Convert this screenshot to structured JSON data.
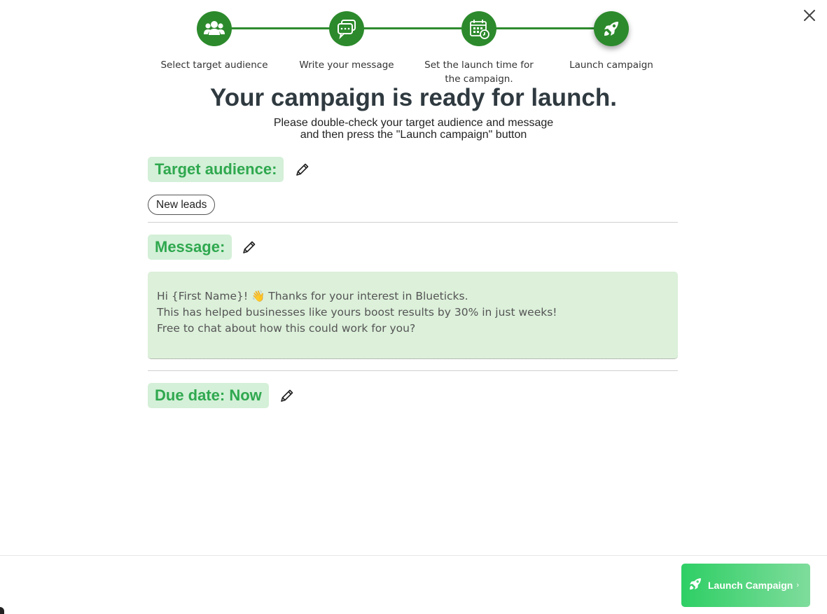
{
  "stepper": {
    "steps": [
      {
        "label": "Select target audience",
        "icon": "users-icon"
      },
      {
        "label": "Write your message",
        "icon": "chat-bubbles-icon"
      },
      {
        "label": "Set the launch time for the campaign.",
        "icon": "calendar-clock-icon"
      },
      {
        "label": "Launch campaign",
        "icon": "rocket-icon",
        "active": true
      }
    ],
    "color": "#2c8a2c"
  },
  "headline": "Your campaign is ready for launch.",
  "subline": {
    "line1": "Please double-check your target audience and message",
    "line2": "and then press the \"Launch campaign\" button"
  },
  "target": {
    "title": "Target audience:",
    "tags": [
      "New leads"
    ]
  },
  "message": {
    "title": "Message:",
    "lines": [
      "Hi {First Name}! 👋 Thanks for your interest in Blueticks.",
      "This has helped businesses like yours boost results by 30% in just weeks!",
      "Free to chat about how this could work for you?"
    ]
  },
  "due": {
    "title": "Due date: Now"
  },
  "footer": {
    "launch_label": "Launch Campaign",
    "launch_chevron": "›"
  },
  "colors": {
    "accent_green": "#2fa84f",
    "chip_bg": "#d4f0d8",
    "message_bg": "#dcf0da"
  }
}
